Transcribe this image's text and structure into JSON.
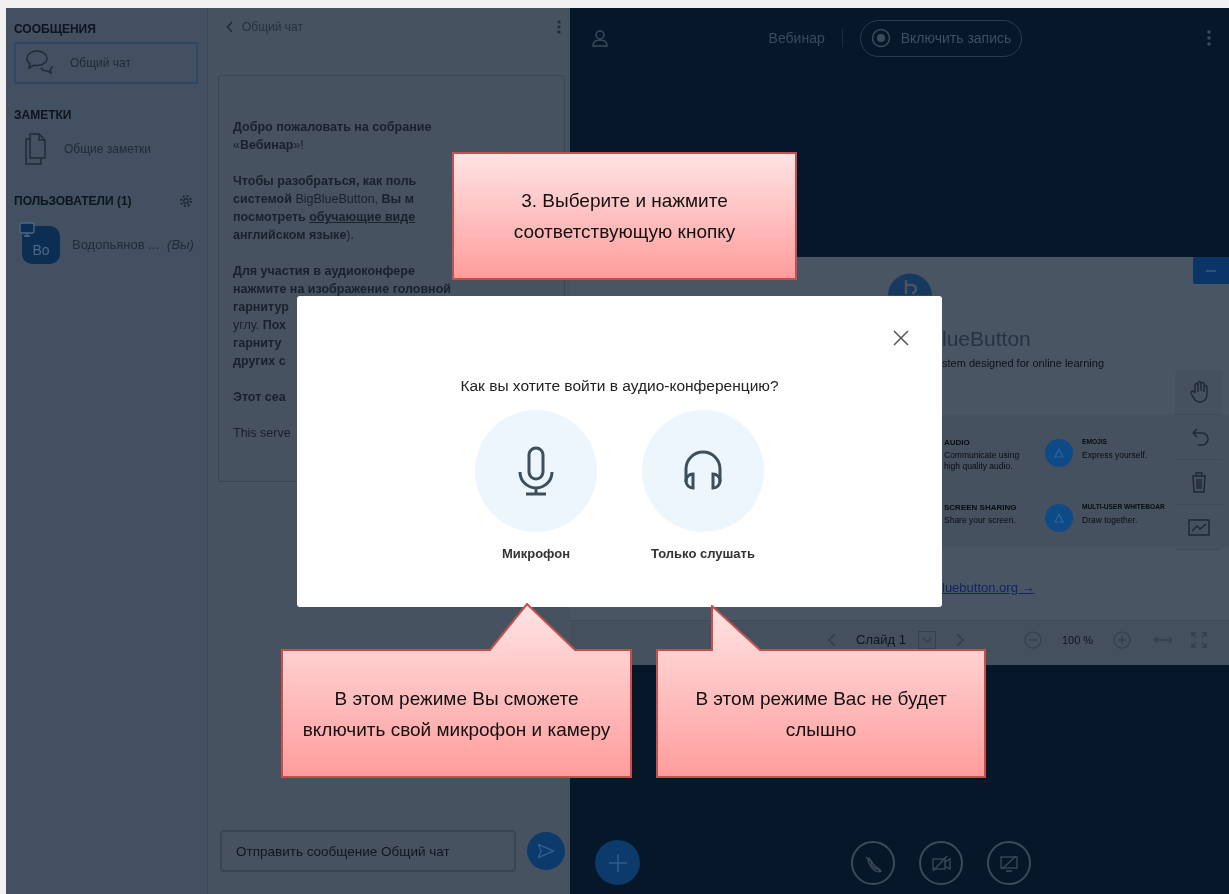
{
  "sidebar": {
    "sections": [
      {
        "title": "СООБЩЕНИЯ",
        "items": [
          {
            "kind": "chat",
            "label": "Общий чат",
            "selected": true
          }
        ]
      },
      {
        "title": "ЗАМЕТКИ",
        "items": [
          {
            "kind": "notes",
            "label": "Общие заметки",
            "selected": false
          }
        ]
      }
    ],
    "users": {
      "title": "ПОЛЬЗОВАТЕЛИ (1)",
      "list": [
        {
          "initials": "Bo",
          "name": "Водопьянов ...",
          "tag": "(Вы)",
          "presenter": true
        }
      ]
    }
  },
  "chat": {
    "title": "Общий чат",
    "welcome": [
      [
        {
          "text": "Добро пожаловать на собрание",
          "bold": true
        },
        {
          "text": "«**Вебинар**»!"
        }
      ],
      [
        {
          "text": "Чтобы разобраться, как поль",
          "bold": true
        },
        {
          "text": "**системой** BigBlueButton, **Вы м**"
        },
        {
          "text": "**посмотреть** ",
          "link": "обучающие виде"
        },
        {
          "text": "**английском языке**)."
        }
      ],
      [
        {
          "text": "Для участия в аудиоконфере",
          "bold": true
        },
        {
          "text": "нажмите на изображение головной",
          "bold": true
        },
        {
          "text": "гарнитур",
          "bold": true
        },
        {
          "text": "углу. **Пох**"
        },
        {
          "text": "гарниту",
          "bold": true
        },
        {
          "text": "других с",
          "bold": true
        }
      ],
      [
        {
          "text": "Этот сеа",
          "bold": true
        }
      ],
      [
        {
          "text": "This serve"
        }
      ]
    ],
    "input": {
      "placeholder": "Отправить сообщение Общий чат"
    }
  },
  "topbar": {
    "meeting": "Вебинар",
    "record": {
      "label": "Включить запись",
      "on": false
    }
  },
  "slide": {
    "title": "lueButton",
    "tagline": "stem designed for online learning",
    "features": [
      {
        "title": "AUDIO",
        "text": "Communicate using high quality audio."
      },
      {
        "title": "EMOJIS",
        "text": "Express yourself."
      },
      {
        "title": "SCREEN SHARING",
        "text": "Share your screen."
      },
      {
        "title": "MULTI-USER WHITEBOAR",
        "text": "Draw together."
      }
    ],
    "link": "luebutton.org →",
    "page": "Слайд 1",
    "zoom": "100 %"
  },
  "modal": {
    "question": "Как вы хотите войти в аудио-конференцию?",
    "options": [
      {
        "kind": "microphone",
        "label": "Микрофон"
      },
      {
        "kind": "headphones",
        "label": "Только слушать"
      }
    ]
  },
  "callouts": [
    {
      "text": "3. Выберите и нажмите соответствующую кнопку"
    },
    {
      "text": "В этом режиме Вы сможете включить свой микрофон и камеру"
    },
    {
      "text": "В этом режиме Вас не будет слышно"
    }
  ]
}
